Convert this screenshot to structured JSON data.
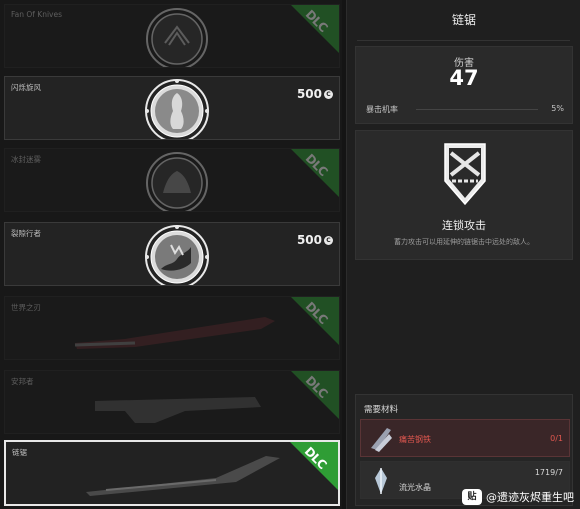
{
  "left_list": {
    "items": [
      {
        "name": "Fan Of Knives",
        "state": "dim",
        "dlc": true
      },
      {
        "name": "闪烁旋风",
        "state": "active",
        "price": "500"
      },
      {
        "name": "冰封迷雾",
        "state": "dim",
        "dlc": true
      },
      {
        "name": "裂隙行者",
        "state": "active",
        "price": "500"
      },
      {
        "name": "世界之刃",
        "state": "dim",
        "dlc": true
      },
      {
        "name": "安邦者",
        "state": "dim",
        "dlc": true
      },
      {
        "name": "链锯",
        "state": "selected",
        "dlc": true
      }
    ],
    "dlc_badge": "DLC",
    "currency_icon": "C"
  },
  "detail": {
    "title": "链锯",
    "damage_label": "伤害",
    "damage_value": "47",
    "crit_label": "暴击机率",
    "crit_value": "5%",
    "mod_name": "连锁攻击",
    "mod_desc": "蓄力攻击可以用延伸的链锯击中远处的敌人。",
    "materials_header": "需要材料",
    "materials": [
      {
        "name": "痛苦钢铁",
        "count": "0/1",
        "status": "missing"
      },
      {
        "name": "流光水晶",
        "count": "1719/7",
        "status": "ok"
      }
    ]
  },
  "watermark": {
    "logo": "贴",
    "text": "@遗迹灰烬重生吧"
  },
  "colors": {
    "dlc_green": "#2f9d35",
    "missing_red": "#e0574f",
    "panel": "#2a2a2a"
  }
}
